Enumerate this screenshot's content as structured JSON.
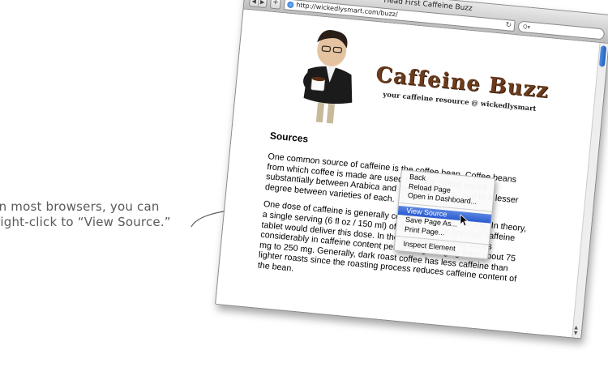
{
  "annotation": {
    "line1": "In most browsers, you can",
    "line2": "right-click to “View Source.”"
  },
  "browser": {
    "window_title": "Head First Caffeine Buzz",
    "url": "http://wickedlysmart.com/buzz/",
    "reload_glyph": "↻",
    "search_placeholder": "Q▾",
    "back_glyph": "◀",
    "forward_glyph": "▶",
    "add_glyph": "+"
  },
  "page": {
    "logo_title": "Caffeine Buzz",
    "tagline": "your caffeine resource @ wickedlysmart",
    "section_heading": "Sources",
    "paragraph1": "One common source of caffeine is the coffee bean. Coffee beans from which coffee is made are used to make coffee varies substantially between Arabica and Robusta beans, and to a lesser degree between varieties of each.",
    "paragraph2": "One dose of caffeine is generally considered to be 100 mg. In theory, a single serving (6 fl oz / 150 ml) of drip coffee or one-half caffeine tablet would deliver this dose. In the real world, coffee varies considerably in caffeine content per serving, ranging from about 75 mg to 250 mg. Generally, dark roast coffee has less caffeine than lighter roasts since the roasting process reduces caffeine content of the bean."
  },
  "context_menu": {
    "items": [
      "Back",
      "Reload Page",
      "Open in Dashboard...",
      "View Source",
      "Save Page As...",
      "Print Page...",
      "Inspect Element"
    ],
    "selected": "View Source"
  }
}
